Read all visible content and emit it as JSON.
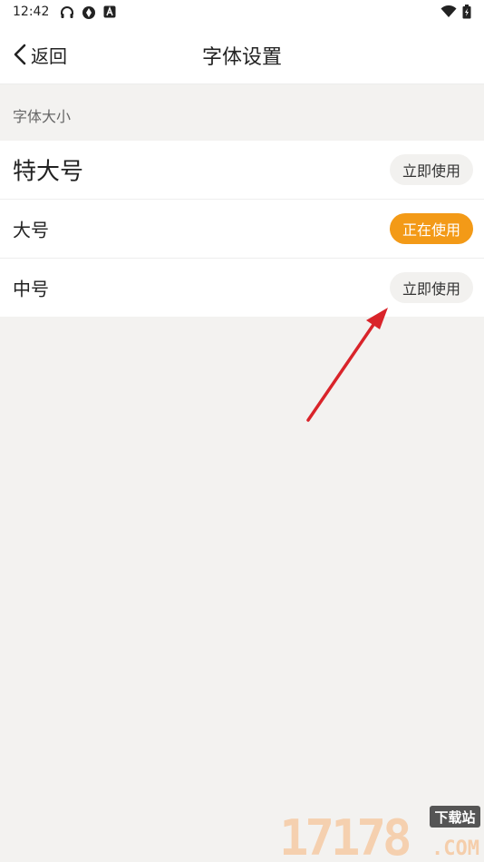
{
  "status_bar": {
    "time": "12:42"
  },
  "nav": {
    "back_label": "返回",
    "title": "字体设置"
  },
  "section": {
    "label": "字体大小"
  },
  "options": [
    {
      "label": "特大号",
      "button": "立即使用",
      "active": false
    },
    {
      "label": "大号",
      "button": "正在使用",
      "active": true
    },
    {
      "label": "中号",
      "button": "立即使用",
      "active": false
    }
  ],
  "colors": {
    "accent": "#f39a17",
    "annotation_arrow": "#d9242a"
  },
  "watermark": {
    "number": "17178",
    "badge": "下载站",
    "domain": ".COM"
  }
}
